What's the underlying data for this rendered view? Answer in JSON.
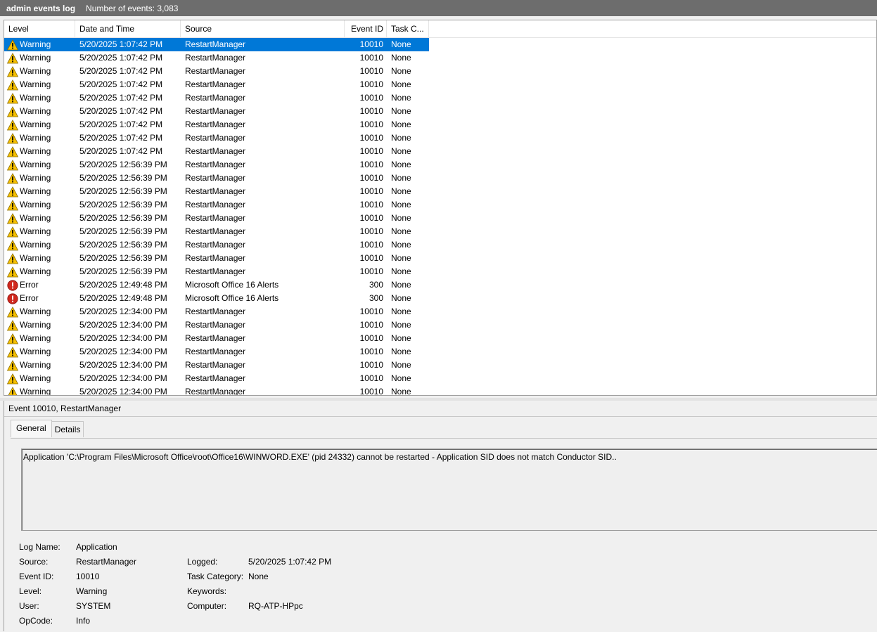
{
  "window": {
    "log_name": "admin events log",
    "event_count_label": "Number of events: 3,083"
  },
  "columns": {
    "level": "Level",
    "date": "Date and Time",
    "source": "Source",
    "event_id": "Event ID",
    "task": "Task C..."
  },
  "events": [
    {
      "level": "Warning",
      "date": "5/20/2025 1:07:42 PM",
      "source": "RestartManager",
      "event_id": "10010",
      "task": "None",
      "icon": "warning-icon",
      "selected": true
    },
    {
      "level": "Warning",
      "date": "5/20/2025 1:07:42 PM",
      "source": "RestartManager",
      "event_id": "10010",
      "task": "None",
      "icon": "warning-icon"
    },
    {
      "level": "Warning",
      "date": "5/20/2025 1:07:42 PM",
      "source": "RestartManager",
      "event_id": "10010",
      "task": "None",
      "icon": "warning-icon"
    },
    {
      "level": "Warning",
      "date": "5/20/2025 1:07:42 PM",
      "source": "RestartManager",
      "event_id": "10010",
      "task": "None",
      "icon": "warning-icon"
    },
    {
      "level": "Warning",
      "date": "5/20/2025 1:07:42 PM",
      "source": "RestartManager",
      "event_id": "10010",
      "task": "None",
      "icon": "warning-icon"
    },
    {
      "level": "Warning",
      "date": "5/20/2025 1:07:42 PM",
      "source": "RestartManager",
      "event_id": "10010",
      "task": "None",
      "icon": "warning-icon"
    },
    {
      "level": "Warning",
      "date": "5/20/2025 1:07:42 PM",
      "source": "RestartManager",
      "event_id": "10010",
      "task": "None",
      "icon": "warning-icon"
    },
    {
      "level": "Warning",
      "date": "5/20/2025 1:07:42 PM",
      "source": "RestartManager",
      "event_id": "10010",
      "task": "None",
      "icon": "warning-icon"
    },
    {
      "level": "Warning",
      "date": "5/20/2025 1:07:42 PM",
      "source": "RestartManager",
      "event_id": "10010",
      "task": "None",
      "icon": "warning-icon"
    },
    {
      "level": "Warning",
      "date": "5/20/2025 12:56:39 PM",
      "source": "RestartManager",
      "event_id": "10010",
      "task": "None",
      "icon": "warning-icon"
    },
    {
      "level": "Warning",
      "date": "5/20/2025 12:56:39 PM",
      "source": "RestartManager",
      "event_id": "10010",
      "task": "None",
      "icon": "warning-icon"
    },
    {
      "level": "Warning",
      "date": "5/20/2025 12:56:39 PM",
      "source": "RestartManager",
      "event_id": "10010",
      "task": "None",
      "icon": "warning-icon"
    },
    {
      "level": "Warning",
      "date": "5/20/2025 12:56:39 PM",
      "source": "RestartManager",
      "event_id": "10010",
      "task": "None",
      "icon": "warning-icon"
    },
    {
      "level": "Warning",
      "date": "5/20/2025 12:56:39 PM",
      "source": "RestartManager",
      "event_id": "10010",
      "task": "None",
      "icon": "warning-icon"
    },
    {
      "level": "Warning",
      "date": "5/20/2025 12:56:39 PM",
      "source": "RestartManager",
      "event_id": "10010",
      "task": "None",
      "icon": "warning-icon"
    },
    {
      "level": "Warning",
      "date": "5/20/2025 12:56:39 PM",
      "source": "RestartManager",
      "event_id": "10010",
      "task": "None",
      "icon": "warning-icon"
    },
    {
      "level": "Warning",
      "date": "5/20/2025 12:56:39 PM",
      "source": "RestartManager",
      "event_id": "10010",
      "task": "None",
      "icon": "warning-icon"
    },
    {
      "level": "Warning",
      "date": "5/20/2025 12:56:39 PM",
      "source": "RestartManager",
      "event_id": "10010",
      "task": "None",
      "icon": "warning-icon"
    },
    {
      "level": "Error",
      "date": "5/20/2025 12:49:48 PM",
      "source": "Microsoft Office 16 Alerts",
      "event_id": "300",
      "task": "None",
      "icon": "error-icon"
    },
    {
      "level": "Error",
      "date": "5/20/2025 12:49:48 PM",
      "source": "Microsoft Office 16 Alerts",
      "event_id": "300",
      "task": "None",
      "icon": "error-icon"
    },
    {
      "level": "Warning",
      "date": "5/20/2025 12:34:00 PM",
      "source": "RestartManager",
      "event_id": "10010",
      "task": "None",
      "icon": "warning-icon"
    },
    {
      "level": "Warning",
      "date": "5/20/2025 12:34:00 PM",
      "source": "RestartManager",
      "event_id": "10010",
      "task": "None",
      "icon": "warning-icon"
    },
    {
      "level": "Warning",
      "date": "5/20/2025 12:34:00 PM",
      "source": "RestartManager",
      "event_id": "10010",
      "task": "None",
      "icon": "warning-icon"
    },
    {
      "level": "Warning",
      "date": "5/20/2025 12:34:00 PM",
      "source": "RestartManager",
      "event_id": "10010",
      "task": "None",
      "icon": "warning-icon"
    },
    {
      "level": "Warning",
      "date": "5/20/2025 12:34:00 PM",
      "source": "RestartManager",
      "event_id": "10010",
      "task": "None",
      "icon": "warning-icon"
    },
    {
      "level": "Warning",
      "date": "5/20/2025 12:34:00 PM",
      "source": "RestartManager",
      "event_id": "10010",
      "task": "None",
      "icon": "warning-icon"
    },
    {
      "level": "Warning",
      "date": "5/20/2025 12:34:00 PM",
      "source": "RestartManager",
      "event_id": "10010",
      "task": "None",
      "icon": "warning-icon"
    }
  ],
  "detail": {
    "header": "Event 10010, RestartManager",
    "tabs": {
      "general": "General",
      "details": "Details"
    },
    "message": "Application 'C:\\Program Files\\Microsoft Office\\root\\Office16\\WINWORD.EXE' (pid 24332) cannot be restarted - Application SID does not match Conductor SID..",
    "labels": {
      "log_name": "Log Name:",
      "source": "Source:",
      "event_id": "Event ID:",
      "level": "Level:",
      "user": "User:",
      "opcode": "OpCode:",
      "logged": "Logged:",
      "task_category": "Task Category:",
      "keywords": "Keywords:",
      "computer": "Computer:"
    },
    "values": {
      "log_name": "Application",
      "source": "RestartManager",
      "event_id": "10010",
      "level": "Warning",
      "user": "SYSTEM",
      "opcode": "Info",
      "logged": "5/20/2025 1:07:42 PM",
      "task_category": "None",
      "keywords": "",
      "computer": "RQ-ATP-HPpc"
    }
  },
  "colors": {
    "selection": "#0078d7",
    "titlebar": "#6d6d6d",
    "warning": "#f6c000",
    "error": "#d0281e"
  }
}
